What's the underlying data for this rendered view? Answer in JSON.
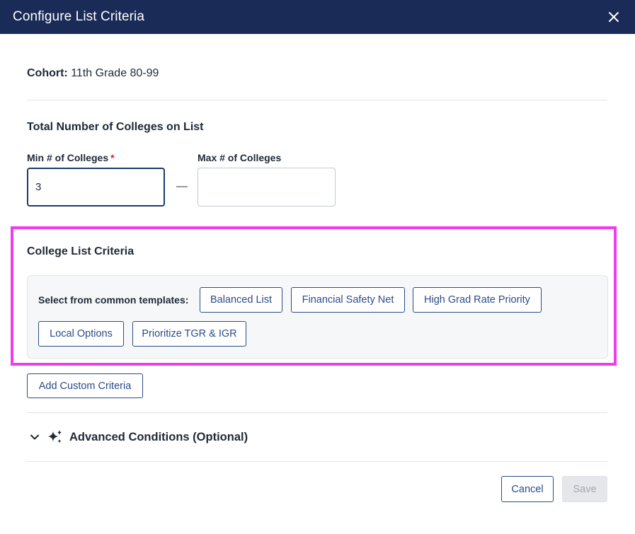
{
  "dialog": {
    "title": "Configure List Criteria",
    "close_icon": "close-icon"
  },
  "cohort": {
    "label": "Cohort:",
    "value": "11th Grade 80-99"
  },
  "total_colleges": {
    "title": "Total Number of Colleges on List",
    "min_label": "Min # of Colleges",
    "required_mark": "*",
    "min_value": "3",
    "separator": "—",
    "max_label": "Max # of Colleges",
    "max_value": ""
  },
  "criteria": {
    "title": "College List Criteria",
    "templates_label": "Select from common templates:",
    "templates": [
      "Balanced List",
      "Financial Safety Net",
      "High Grad Rate Priority",
      "Local Options",
      "Prioritize TGR & IGR"
    ],
    "add_custom_label": "Add Custom Criteria"
  },
  "advanced": {
    "chevron_icon": "chevron-down-icon",
    "sparkle_icon": "sparkle-icon",
    "label": "Advanced Conditions (Optional)"
  },
  "footer": {
    "cancel_label": "Cancel",
    "save_label": "Save"
  },
  "colors": {
    "header_bg": "#1a2b57",
    "primary": "#2b4a8a",
    "required": "#d0213a",
    "highlight": "#f03cf0",
    "disabled_bg": "#e5e7ea"
  }
}
